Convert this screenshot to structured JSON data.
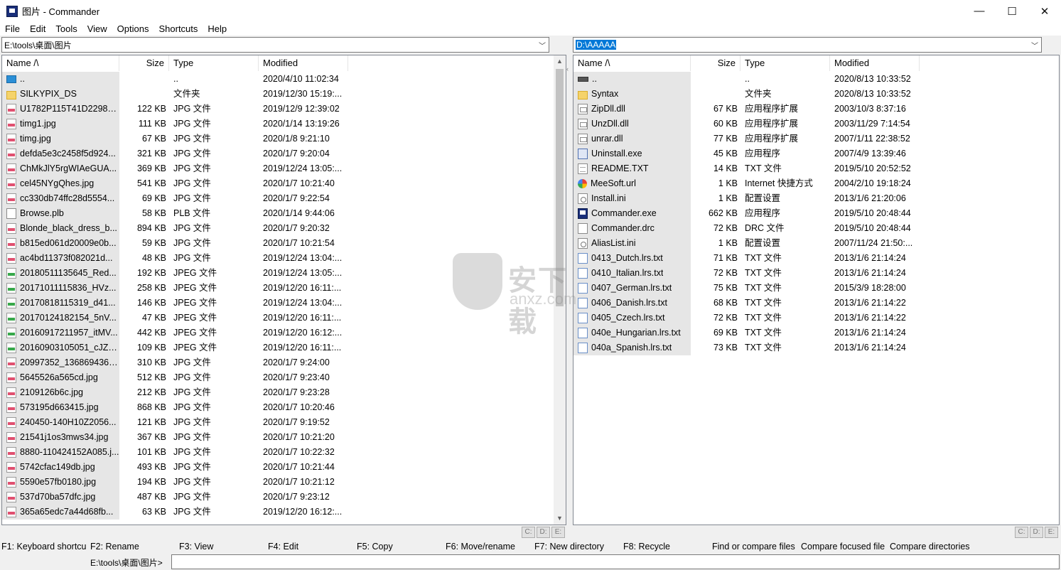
{
  "window": {
    "title": "图片 - Commander",
    "minimize": "—",
    "maximize": "☐",
    "close": "✕"
  },
  "menu": [
    "File",
    "Edit",
    "Tools",
    "View",
    "Options",
    "Shortcuts",
    "Help"
  ],
  "left_panel": {
    "path": "E:\\tools\\桌面\\图片",
    "headers": {
      "name": "Name /\\",
      "size": "Size",
      "type": "Type",
      "modified": "Modified"
    },
    "rows": [
      {
        "icon": "up",
        "name": "..",
        "size": "",
        "type": "..",
        "modified": "2020/4/10 11:02:34"
      },
      {
        "icon": "folder",
        "name": "SILKYPIX_DS",
        "size": "",
        "type": "文件夹",
        "modified": "2019/12/30 15:19:..."
      },
      {
        "icon": "jpg",
        "name": "U1782P115T41D22987...",
        "size": "122 KB",
        "type": "JPG 文件",
        "modified": "2019/12/9 12:39:02"
      },
      {
        "icon": "jpg",
        "name": "timg1.jpg",
        "size": "111 KB",
        "type": "JPG 文件",
        "modified": "2020/1/14 13:19:26"
      },
      {
        "icon": "jpg",
        "name": "timg.jpg",
        "size": "67 KB",
        "type": "JPG 文件",
        "modified": "2020/1/8 9:21:10"
      },
      {
        "icon": "jpg",
        "name": "defda5e3c2458f5d924...",
        "size": "321 KB",
        "type": "JPG 文件",
        "modified": "2020/1/7 9:20:04"
      },
      {
        "icon": "jpg",
        "name": "ChMkJlY5rgWIAeGUA...",
        "size": "369 KB",
        "type": "JPG 文件",
        "modified": "2019/12/24 13:05:..."
      },
      {
        "icon": "jpg",
        "name": "cel45NYgQhes.jpg",
        "size": "541 KB",
        "type": "JPG 文件",
        "modified": "2020/1/7 10:21:40"
      },
      {
        "icon": "jpg",
        "name": "cc330db74ffc28d5554...",
        "size": "69 KB",
        "type": "JPG 文件",
        "modified": "2020/1/7 9:22:54"
      },
      {
        "icon": "file",
        "name": "Browse.plb",
        "size": "58 KB",
        "type": "PLB 文件",
        "modified": "2020/1/14 9:44:06"
      },
      {
        "icon": "jpg",
        "name": "Blonde_black_dress_b...",
        "size": "894 KB",
        "type": "JPG 文件",
        "modified": "2020/1/7 9:20:32"
      },
      {
        "icon": "jpg",
        "name": "b815ed061d20009e0b...",
        "size": "59 KB",
        "type": "JPG 文件",
        "modified": "2020/1/7 10:21:54"
      },
      {
        "icon": "jpg",
        "name": "ac4bd11373f082021d...",
        "size": "48 KB",
        "type": "JPG 文件",
        "modified": "2019/12/24 13:04:..."
      },
      {
        "icon": "jpeg",
        "name": "20180511135645_Red...",
        "size": "192 KB",
        "type": "JPEG 文件",
        "modified": "2019/12/24 13:05:..."
      },
      {
        "icon": "jpeg",
        "name": "20171011115836_HVz...",
        "size": "258 KB",
        "type": "JPEG 文件",
        "modified": "2019/12/20 16:11:..."
      },
      {
        "icon": "jpeg",
        "name": "20170818115319_d41...",
        "size": "146 KB",
        "type": "JPEG 文件",
        "modified": "2019/12/24 13:04:..."
      },
      {
        "icon": "jpeg",
        "name": "20170124182154_5nV...",
        "size": "47 KB",
        "type": "JPEG 文件",
        "modified": "2019/12/20 16:11:..."
      },
      {
        "icon": "jpeg",
        "name": "20160917211957_itMV...",
        "size": "442 KB",
        "type": "JPEG 文件",
        "modified": "2019/12/20 16:12:..."
      },
      {
        "icon": "jpeg",
        "name": "20160903105051_cJZh...",
        "size": "109 KB",
        "type": "JPEG 文件",
        "modified": "2019/12/20 16:11:..."
      },
      {
        "icon": "jpg",
        "name": "20997352_1368694364...",
        "size": "310 KB",
        "type": "JPG 文件",
        "modified": "2020/1/7 9:24:00"
      },
      {
        "icon": "jpg",
        "name": "5645526a565cd.jpg",
        "size": "512 KB",
        "type": "JPG 文件",
        "modified": "2020/1/7 9:23:40"
      },
      {
        "icon": "jpg",
        "name": "2109126b6c.jpg",
        "size": "212 KB",
        "type": "JPG 文件",
        "modified": "2020/1/7 9:23:28"
      },
      {
        "icon": "jpg",
        "name": "573195d663415.jpg",
        "size": "868 KB",
        "type": "JPG 文件",
        "modified": "2020/1/7 10:20:46"
      },
      {
        "icon": "jpg",
        "name": "240450-140H10Z2056...",
        "size": "121 KB",
        "type": "JPG 文件",
        "modified": "2020/1/7 9:19:52"
      },
      {
        "icon": "jpg",
        "name": "21541j1os3mws34.jpg",
        "size": "367 KB",
        "type": "JPG 文件",
        "modified": "2020/1/7 10:21:20"
      },
      {
        "icon": "jpg",
        "name": "8880-110424152A085.j...",
        "size": "101 KB",
        "type": "JPG 文件",
        "modified": "2020/1/7 10:22:32"
      },
      {
        "icon": "jpg",
        "name": "5742cfac149db.jpg",
        "size": "493 KB",
        "type": "JPG 文件",
        "modified": "2020/1/7 10:21:44"
      },
      {
        "icon": "jpg",
        "name": "5590e57fb0180.jpg",
        "size": "194 KB",
        "type": "JPG 文件",
        "modified": "2020/1/7 10:21:12"
      },
      {
        "icon": "jpg",
        "name": "537d70ba57dfc.jpg",
        "size": "487 KB",
        "type": "JPG 文件",
        "modified": "2020/1/7 9:23:12"
      },
      {
        "icon": "jpg",
        "name": "365a65edc7a44d68fb...",
        "size": "63 KB",
        "type": "JPG 文件",
        "modified": "2019/12/20 16:12:..."
      }
    ],
    "drives": [
      "C:",
      "D:",
      "E:"
    ]
  },
  "right_panel": {
    "path": "D:\\AAAAA",
    "headers": {
      "name": "Name /\\",
      "size": "Size",
      "type": "Type",
      "modified": "Modified"
    },
    "rows": [
      {
        "icon": "drive",
        "name": "..",
        "size": "",
        "type": "..",
        "modified": "2020/8/13 10:33:52"
      },
      {
        "icon": "folder",
        "name": "Syntax",
        "size": "",
        "type": "文件夹",
        "modified": "2020/8/13 10:33:52"
      },
      {
        "icon": "dll",
        "name": "ZipDll.dll",
        "size": "67 KB",
        "type": "应用程序扩展",
        "modified": "2003/10/3 8:37:16"
      },
      {
        "icon": "dll",
        "name": "UnzDll.dll",
        "size": "60 KB",
        "type": "应用程序扩展",
        "modified": "2003/11/29 7:14:54"
      },
      {
        "icon": "dll",
        "name": "unrar.dll",
        "size": "77 KB",
        "type": "应用程序扩展",
        "modified": "2007/1/11 22:38:52"
      },
      {
        "icon": "exe",
        "name": "Uninstall.exe",
        "size": "45 KB",
        "type": "应用程序",
        "modified": "2007/4/9 13:39:46"
      },
      {
        "icon": "txt",
        "name": "README.TXT",
        "size": "14 KB",
        "type": "TXT 文件",
        "modified": "2019/5/10 20:52:52"
      },
      {
        "icon": "url",
        "name": "MeeSoft.url",
        "size": "1 KB",
        "type": "Internet 快捷方式",
        "modified": "2004/2/10 19:18:24"
      },
      {
        "icon": "ini",
        "name": "Install.ini",
        "size": "1 KB",
        "type": "配置设置",
        "modified": "2013/1/6 21:20:06"
      },
      {
        "icon": "cmd",
        "name": "Commander.exe",
        "size": "662 KB",
        "type": "应用程序",
        "modified": "2019/5/10 20:48:44"
      },
      {
        "icon": "file",
        "name": "Commander.drc",
        "size": "72 KB",
        "type": "DRC 文件",
        "modified": "2019/5/10 20:48:44"
      },
      {
        "icon": "ini",
        "name": "AliasList.ini",
        "size": "1 KB",
        "type": "配置设置",
        "modified": "2007/11/24 21:50:..."
      },
      {
        "icon": "lrs",
        "name": "0413_Dutch.lrs.txt",
        "size": "71 KB",
        "type": "TXT 文件",
        "modified": "2013/1/6 21:14:24"
      },
      {
        "icon": "lrs",
        "name": "0410_Italian.lrs.txt",
        "size": "72 KB",
        "type": "TXT 文件",
        "modified": "2013/1/6 21:14:24"
      },
      {
        "icon": "lrs",
        "name": "0407_German.lrs.txt",
        "size": "75 KB",
        "type": "TXT 文件",
        "modified": "2015/3/9 18:28:00"
      },
      {
        "icon": "lrs",
        "name": "0406_Danish.lrs.txt",
        "size": "68 KB",
        "type": "TXT 文件",
        "modified": "2013/1/6 21:14:22"
      },
      {
        "icon": "lrs",
        "name": "0405_Czech.lrs.txt",
        "size": "72 KB",
        "type": "TXT 文件",
        "modified": "2013/1/6 21:14:22"
      },
      {
        "icon": "lrs",
        "name": "040e_Hungarian.lrs.txt",
        "size": "69 KB",
        "type": "TXT 文件",
        "modified": "2013/1/6 21:14:24"
      },
      {
        "icon": "lrs",
        "name": "040a_Spanish.lrs.txt",
        "size": "73 KB",
        "type": "TXT 文件",
        "modified": "2013/1/6 21:14:24"
      }
    ],
    "drives": [
      "C:",
      "D:",
      "E:"
    ]
  },
  "function_keys": [
    "F1: Keyboard shortcu",
    "F2: Rename",
    "F3: View",
    "F4: Edit",
    "F5: Copy",
    "F6: Move/rename",
    "F7: New directory",
    "F8: Recycle",
    "Find or compare files",
    "Compare focused file",
    "Compare directories"
  ],
  "command_line": {
    "label": "E:\\tools\\桌面\\图片>",
    "value": ""
  },
  "watermark": {
    "text": "安下载",
    "sub": "anxz.com"
  }
}
